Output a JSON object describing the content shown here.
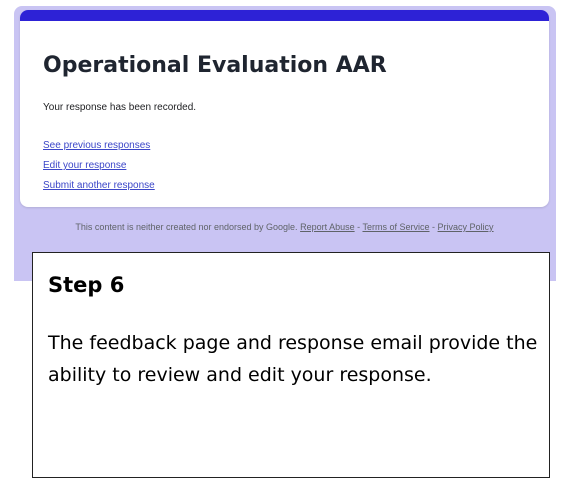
{
  "form": {
    "title": "Operational Evaluation AAR",
    "confirmation_message": "Your response has been recorded.",
    "links": [
      "See previous responses",
      "Edit your response",
      "Submit another response"
    ]
  },
  "footer": {
    "disclaimer": "This content is neither created nor endorsed by Google.",
    "report_abuse": "Report Abuse",
    "separator": "-",
    "terms": "Terms of Service",
    "privacy": "Privacy Policy"
  },
  "callout": {
    "heading": "Step 6",
    "body": "The feedback page and response email provide the ability to review and edit your response."
  },
  "colors": {
    "accent": "#2d22d6",
    "background": "#c9c4f3",
    "link": "#3b46c8"
  }
}
